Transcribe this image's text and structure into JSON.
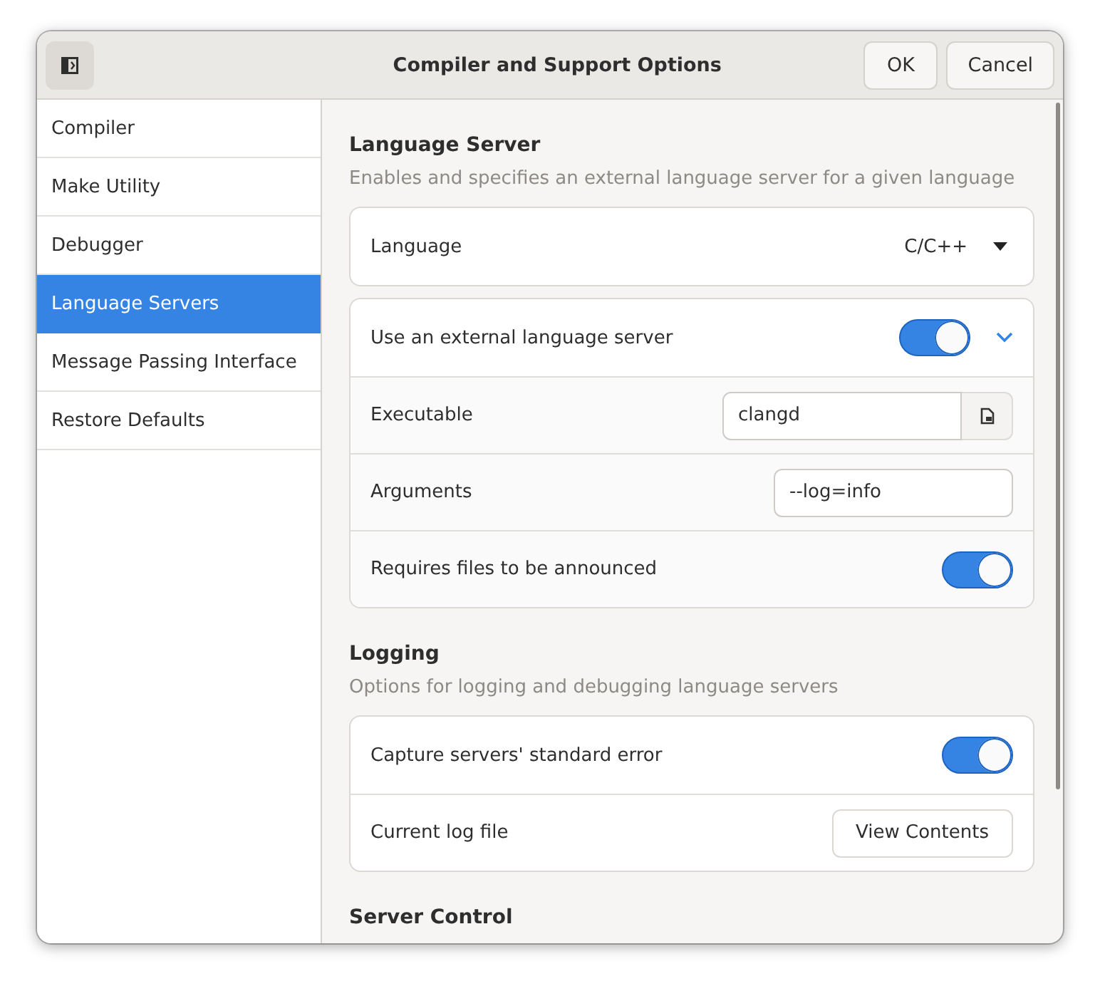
{
  "window": {
    "title": "Compiler and Support Options",
    "buttons": [
      {
        "label": "OK",
        "kind": "ok"
      },
      {
        "label": "Cancel",
        "kind": "cancel"
      }
    ]
  },
  "sidebar": {
    "items": [
      {
        "label": "Compiler",
        "selected": false
      },
      {
        "label": "Make Utility",
        "selected": false
      },
      {
        "label": "Debugger",
        "selected": false
      },
      {
        "label": "Language Servers",
        "selected": true
      },
      {
        "label": "Message Passing Interface",
        "selected": false
      },
      {
        "label": "Restore Defaults",
        "selected": false
      }
    ]
  },
  "sections": [
    {
      "title": "Language Server",
      "description": "Enables and specifies an external language server for a given language",
      "groups": [
        {
          "rows": [
            {
              "kind": "dropdown",
              "label": "Language",
              "value": "C/C++"
            }
          ]
        },
        {
          "rows": [
            {
              "kind": "expander",
              "label": "Use an external language server",
              "on": true,
              "expanded": true
            },
            {
              "kind": "file",
              "label": "Executable",
              "value": "clangd"
            },
            {
              "kind": "entry",
              "label": "Arguments",
              "value": "--log=info"
            },
            {
              "kind": "switch",
              "label": "Requires files to be announced",
              "on": true
            }
          ]
        }
      ]
    },
    {
      "title": "Logging",
      "description": "Options for logging and debugging language servers",
      "groups": [
        {
          "rows": [
            {
              "kind": "switch",
              "label": "Capture servers' standard error",
              "on": true
            },
            {
              "kind": "button",
              "label": "Current log file",
              "value": "View Contents"
            }
          ]
        }
      ]
    },
    {
      "title": "Server Control"
    }
  ]
}
